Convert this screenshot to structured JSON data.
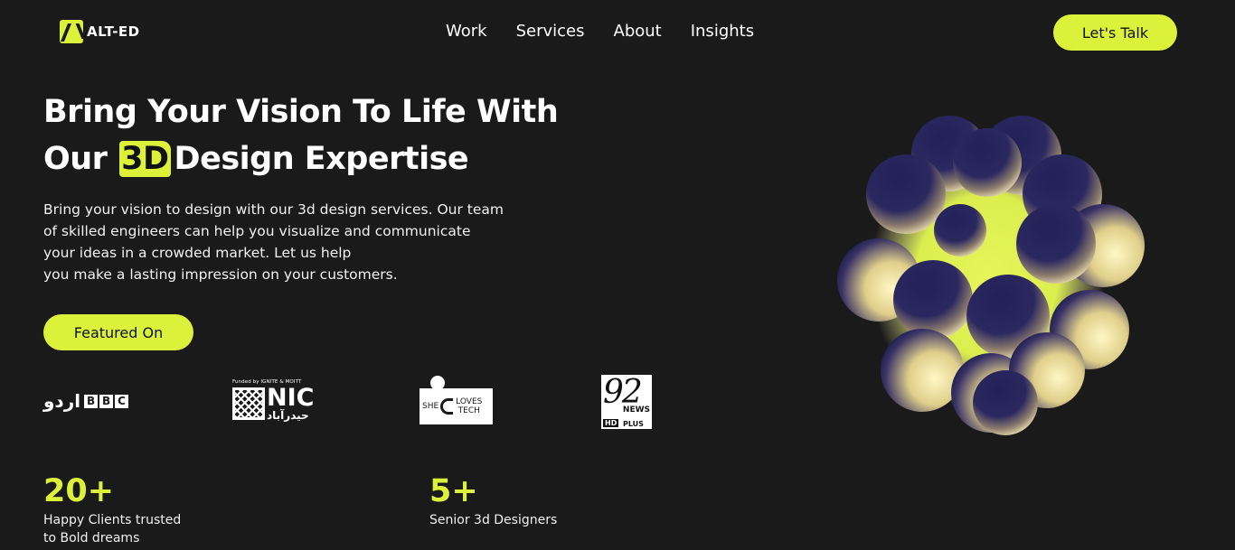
{
  "brand": {
    "name": "ALT-ED",
    "accent": "#dcf23a",
    "background": "#1b1a1b"
  },
  "nav": {
    "items": [
      "Work",
      "Services",
      "About",
      "Insights"
    ]
  },
  "header": {
    "cta_label": "Let's Talk"
  },
  "hero": {
    "title_line1": "Bring Your Vision To Life With",
    "title_prefix": "Our",
    "title_badge": "3D",
    "title_suffix": "Design Expertise",
    "description_lines": [
      "Bring your vision to design with our 3d design services. Our team",
      "of skilled engineers can help you visualize and communicate",
      "your ideas in a crowded market. Let us help",
      "you make a lasting impression on your customers."
    ],
    "featured_label": "Featured On"
  },
  "press": {
    "bbc": {
      "urdu": "اردو",
      "letters": [
        "B",
        "B",
        "C"
      ]
    },
    "nic": {
      "funded": "Funded by IGNITE & MOITT",
      "name": "NIC",
      "urdu": "حیدرآباد"
    },
    "she": {
      "she": "SHE",
      "loves": "LOVES",
      "tech": "TECH"
    },
    "news92": {
      "number": "92",
      "news": "NEWS",
      "hd": "HD",
      "plus": "PLUS"
    }
  },
  "stats": [
    {
      "value": "20+",
      "label_line1": "Happy Clients trusted",
      "label_line2": "to Bold dreams"
    },
    {
      "value": "5+",
      "label_line1": "Senior 3d Designers"
    }
  ]
}
